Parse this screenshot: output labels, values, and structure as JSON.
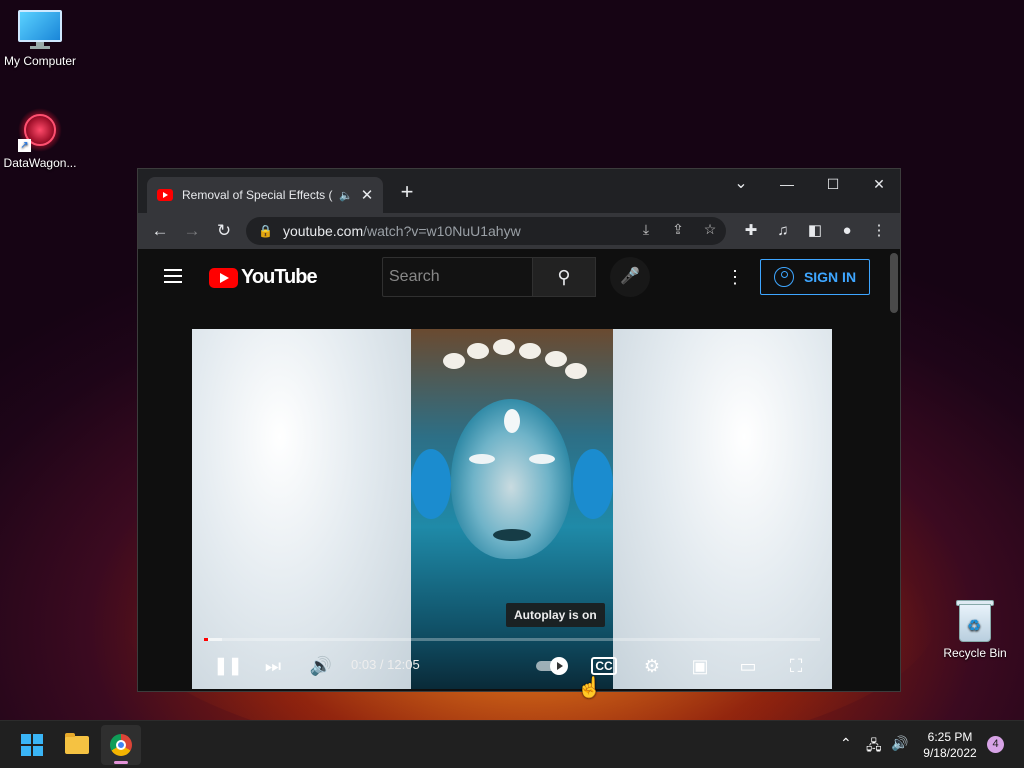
{
  "desktop": {
    "icons": [
      {
        "label": "My Computer"
      },
      {
        "label": "DataWagon..."
      },
      {
        "label": "Recycle Bin"
      }
    ]
  },
  "browser": {
    "tab": {
      "title": "Removal of Special Effects (S",
      "favicon": "youtube-icon",
      "audio": "speaker-icon",
      "close": "✕"
    },
    "new_tab": "+",
    "window_controls": {
      "dropdown": "⌄",
      "minimize": "—",
      "maximize": "☐",
      "close": "✕"
    },
    "url_host": "youtube.com",
    "url_path": "/watch?v=w10NuU1ahyw",
    "toolbar_icons": [
      "install-icon",
      "share-icon",
      "bookmark-star-icon",
      "extensions-icon",
      "media-control-icon",
      "side-panel-icon",
      "profile-icon",
      "menu-icon"
    ]
  },
  "youtube": {
    "logo_text": "YouTube",
    "search_placeholder": "Search",
    "sign_in": "SIGN IN"
  },
  "player": {
    "time": "0:03 / 12:05",
    "tooltip": "Autoplay is on",
    "progress_played": 0.004,
    "progress_loaded": 0.03,
    "autoplay_on": true
  },
  "taskbar": {
    "time": "6:25 PM",
    "date": "9/18/2022",
    "notifications": "4",
    "apps": [
      "start-icon",
      "file-explorer-icon",
      "chrome-icon"
    ],
    "tray": [
      "chevron-up-icon",
      "network-icon",
      "volume-icon"
    ]
  },
  "colors": {
    "youtube_red": "#ff0000",
    "signin_blue": "#3ea6ff",
    "progress_red": "#ff0000"
  }
}
